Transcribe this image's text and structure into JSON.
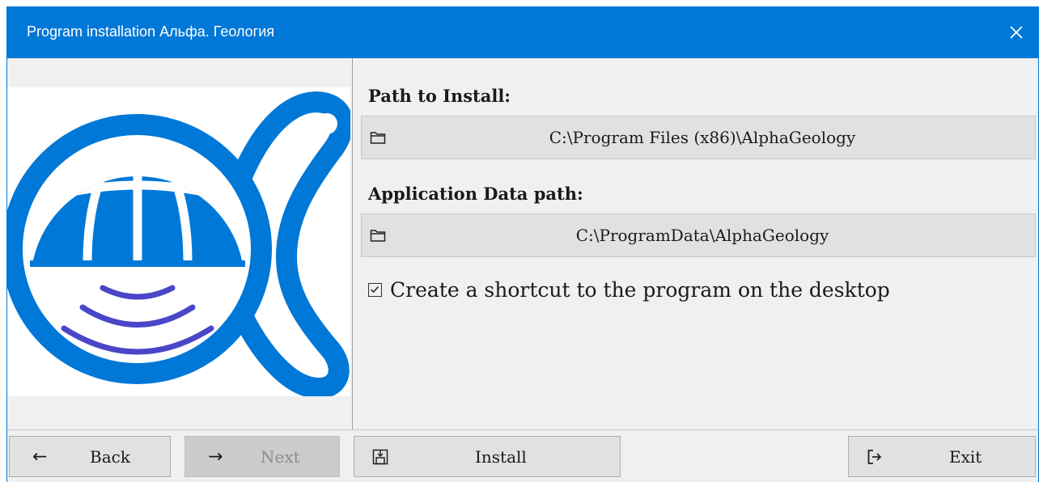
{
  "window": {
    "title": "Program installation Альфа. Геология"
  },
  "install_path": {
    "label": "Path to Install:",
    "value": "C:\\Program Files (x86)\\AlphaGeology"
  },
  "data_path": {
    "label": "Application Data path:",
    "value": "C:\\ProgramData\\AlphaGeology"
  },
  "shortcut": {
    "label": "Create a shortcut to the program on the desktop",
    "checked": true
  },
  "buttons": {
    "back": "Back",
    "next": "Next",
    "install": "Install",
    "exit": "Exit"
  },
  "colors": {
    "accent": "#0078d7",
    "arcs": "#4a46c8"
  }
}
